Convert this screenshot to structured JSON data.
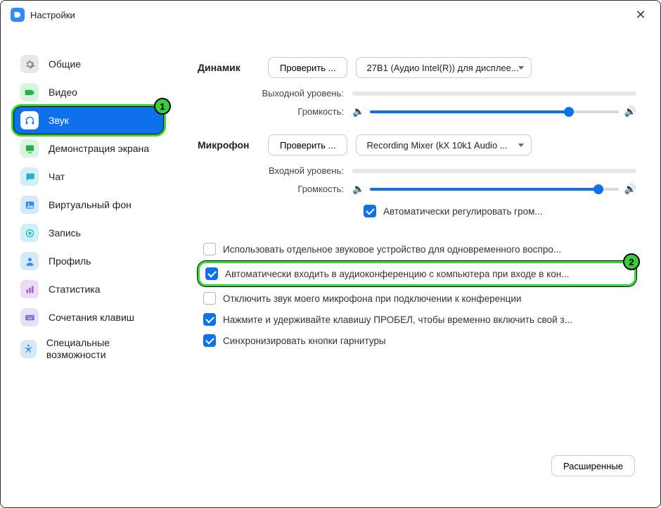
{
  "window": {
    "title": "Настройки"
  },
  "sidebar": {
    "items": [
      {
        "label": "Общие"
      },
      {
        "label": "Видео"
      },
      {
        "label": "Звук"
      },
      {
        "label": "Демонстрация экрана"
      },
      {
        "label": "Чат"
      },
      {
        "label": "Виртуальный фон"
      },
      {
        "label": "Запись"
      },
      {
        "label": "Профиль"
      },
      {
        "label": "Статистика"
      },
      {
        "label": "Сочетания клавиш"
      },
      {
        "label": "Специальные возможности"
      }
    ]
  },
  "badges": {
    "one": "1",
    "two": "2"
  },
  "audio": {
    "speaker": {
      "heading": "Динамик",
      "test_button": "Проверить ...",
      "device": "27B1 (Аудио Intel(R)) для дисплее...",
      "output_level_label": "Выходной уровень:",
      "volume_label": "Громкость:",
      "volume_percent": 80
    },
    "mic": {
      "heading": "Микрофон",
      "test_button": "Проверить ...",
      "device": "Recording Mixer (kX 10k1 Audio ...",
      "input_level_label": "Входной уровень:",
      "volume_label": "Громкость:",
      "volume_percent": 92,
      "auto_adjust": "Автоматически регулировать гром..."
    },
    "options": {
      "separate_device": "Использовать отдельное звуковое устройство для одновременного воспро...",
      "auto_join": "Автоматически входить в аудиоконференцию с компьютера при входе в кон...",
      "mute_on_join": "Отключить звук моего микрофона при подключении к конференции",
      "push_to_talk": "Нажмите и удерживайте клавишу ПРОБЕЛ, чтобы временно включить свой з...",
      "sync_headset": "Синхронизировать кнопки гарнитуры"
    },
    "advanced_button": "Расширенные"
  }
}
